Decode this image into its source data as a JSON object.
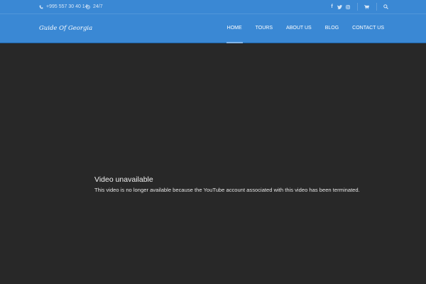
{
  "topbar": {
    "phone": "+995 557 30 40 14",
    "hours": "24/7",
    "social": [
      {
        "icon": "facebook-icon",
        "glyph": "f"
      },
      {
        "icon": "twitter-icon",
        "glyph": ""
      },
      {
        "icon": "instagram-icon",
        "glyph": ""
      }
    ],
    "cart_icon": "cart-icon",
    "search_icon": "search-icon"
  },
  "navbar": {
    "logo": "Guide Of Georgia",
    "menu": [
      {
        "label": "HOME",
        "active": true
      },
      {
        "label": "TOURS",
        "active": false
      },
      {
        "label": "ABOUT US",
        "active": false
      },
      {
        "label": "BLOG",
        "active": false
      },
      {
        "label": "CONTACT US",
        "active": false
      }
    ]
  },
  "video": {
    "title": "Video unavailable",
    "message": "This video is no longer available because the YouTube account associated with this video has been terminated."
  },
  "colors": {
    "header_bg": "#3a88d4",
    "video_bg": "#282828",
    "active_indicator": "#7fb4ea"
  }
}
